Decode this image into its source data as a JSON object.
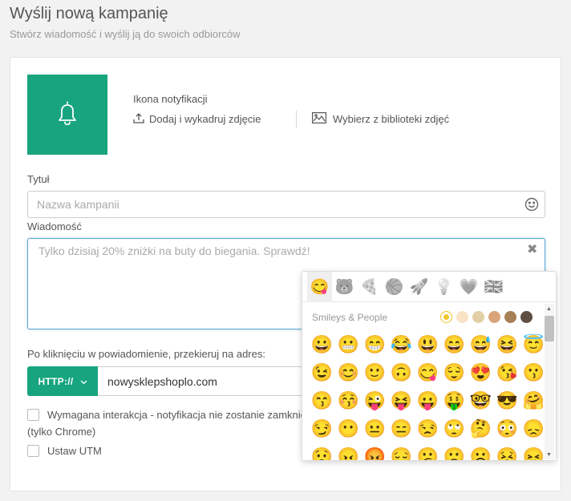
{
  "header": {
    "title": "Wyślij nową kampanię",
    "subtitle": "Stwórz wiadomość i wyślij ją do swoich odbiorców"
  },
  "icon_section": {
    "label": "Ikona notyfikacji",
    "upload_label": "Dodaj i wykadruj zdjęcie",
    "library_label": "Wybierz z biblioteki zdjęć",
    "icon": "bell-icon",
    "bg_color": "#17a47f"
  },
  "title_field": {
    "label": "Tytuł",
    "placeholder": "Nazwa kampanii",
    "value": ""
  },
  "message_field": {
    "label": "Wiadomość",
    "placeholder": "Tylko dzisiaj 20% zniżki na buty do biegania. Sprawdź!",
    "value": ""
  },
  "redirect": {
    "label": "Po kliknięciu w powiadomienie, przekieruj na adres:",
    "protocol": "HTTP://",
    "url": "nowysklepshoplo.com"
  },
  "options": {
    "require_interaction_label": "Wymagana interakcja - notyfikacja nie zostanie zamknie",
    "chrome_note": "(tylko Chrome)",
    "utm_label": "Ustaw UTM"
  },
  "emoji_picker": {
    "category_label": "Smileys & People",
    "tabs": [
      "😋",
      "🐻",
      "🍕",
      "🏀",
      "🚀",
      "💡",
      "💗",
      "🇬🇧"
    ],
    "tones": [
      "#f4c431",
      "#fae3c5",
      "#e2cfa5",
      "#daa478",
      "#a78058",
      "#5e4d43"
    ],
    "emojis": [
      "😀",
      "😬",
      "😁",
      "😂",
      "😃",
      "😄",
      "😅",
      "😆",
      "😇",
      "😉",
      "😊",
      "🙂",
      "🙃",
      "😋",
      "😌",
      "😍",
      "😘",
      "😗",
      "😙",
      "😚",
      "😜",
      "😝",
      "😛",
      "🤑",
      "🤓",
      "😎",
      "🤗",
      "😏",
      "😶",
      "😐",
      "😑",
      "😒",
      "🙄",
      "🤔",
      "😳",
      "😞",
      "😟",
      "😠",
      "😡",
      "😔",
      "😕",
      "🙁",
      "☹️",
      "😣",
      "😖"
    ]
  },
  "colors": {
    "accent": "#17a47f",
    "focus_border": "#5fa8d3"
  }
}
